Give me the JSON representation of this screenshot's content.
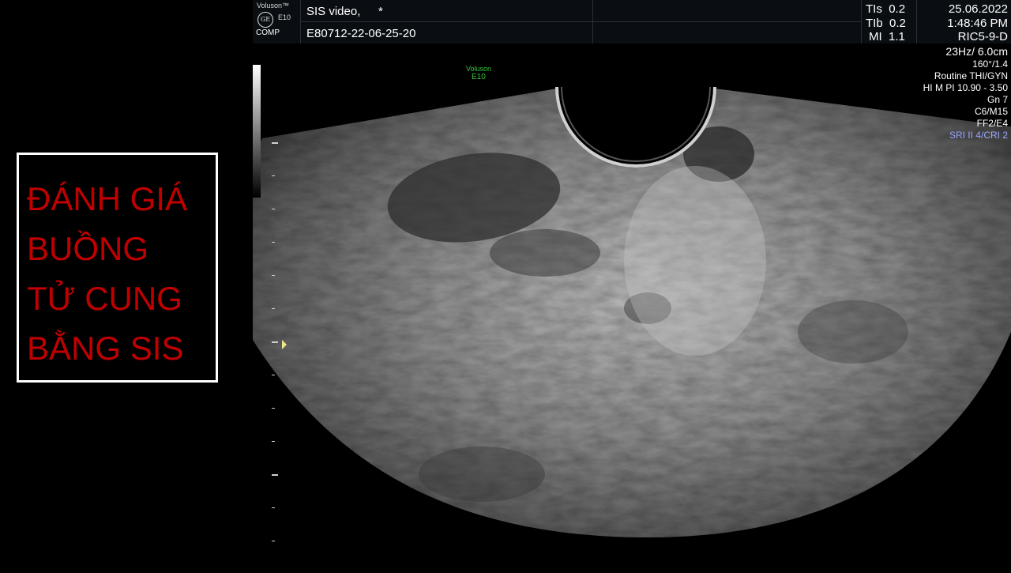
{
  "title_box": {
    "lines": [
      "ĐÁNH GIÁ",
      "BUỒNG",
      "TỬ CUNG",
      "BẰNG SIS"
    ],
    "text_color": "#c00000",
    "border_color": "#ffffff"
  },
  "header": {
    "brand": "Voluson™",
    "model": "E10",
    "logo_label": "GE",
    "comp_label": "COMP",
    "study_title": "SIS video,",
    "study_marker": "*",
    "study_id": "E80712-22-06-25-20",
    "indices": [
      {
        "label": "TIs",
        "value": "0.2"
      },
      {
        "label": "TIb",
        "value": "0.2"
      },
      {
        "label": "MI",
        "value": "1.1"
      }
    ],
    "date": "25.06.2022",
    "time": "1:48:46 PM",
    "probe": "RIC5-9-D"
  },
  "parameters": {
    "frame_depth": "23Hz/ 6.0cm",
    "lines": [
      "160°/1.4",
      "Routine THI/GYN",
      "HI M PI 10.90 - 3.50",
      "Gn  7",
      "C6/M15",
      "FF2/E4"
    ],
    "sri": "SRI II 4/CRI 2",
    "sri_color": "#9aa8ff"
  },
  "image_watermark": {
    "line1": "Voluson",
    "line2": "E10",
    "color": "#38c838"
  }
}
